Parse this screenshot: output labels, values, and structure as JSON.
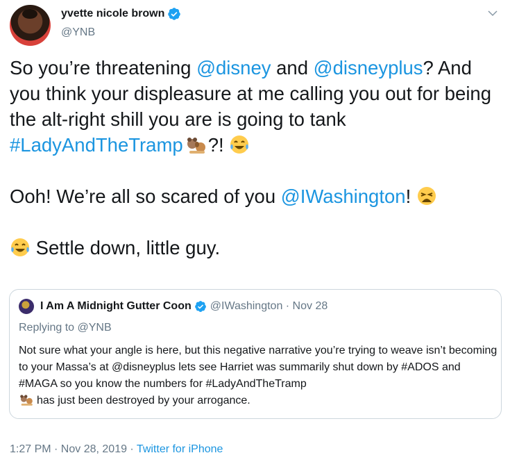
{
  "author": {
    "display_name": "yvette nicole brown",
    "handle": "@YNB"
  },
  "tweet": {
    "line1_a": "So you’re threatening ",
    "mention1": "@disney",
    "line1_b": " and ",
    "mention2": "@disneyplus",
    "line1_c": "? And you think your displeasure at me calling you out for being the alt-right shill you are is going to tank ",
    "hashtag": "#LadyAndTheTramp",
    "line1_d": "?! ",
    "line2_a": "Ooh! We’re all so scared of you ",
    "mention3": "@IWashington",
    "line2_b": "! ",
    "line3": " Settle down, little guy."
  },
  "quote": {
    "name": "I Am A Midnight Gutter Coon",
    "handle_date": "@IWashington · Nov 28",
    "replying_to": "Replying to @YNB",
    "body": "Not sure what your angle is here, but this negative narrative you’re trying to weave isn’t becoming to your Massa’s at @disneyplus lets see Harriet was summarily shut down by #ADOS and #MAGA so you know the numbers for #LadyAndTheTramp",
    "body_end": "has just been destroyed by your arrogance."
  },
  "meta": {
    "timestamp": "1:27 PM · Nov 28, 2019 · ",
    "source": "Twitter for iPhone"
  },
  "icons": {
    "verified": "verified-badge-icon",
    "caret": "chevron-down-icon",
    "emoji_laugh": "face-with-tears-of-joy",
    "emoji_weary": "weary-face",
    "emoji_dogs": "lady-and-tramp-dogs"
  },
  "colors": {
    "link": "#1b95e0",
    "secondary": "#657786",
    "verified": "#1da1f2"
  }
}
